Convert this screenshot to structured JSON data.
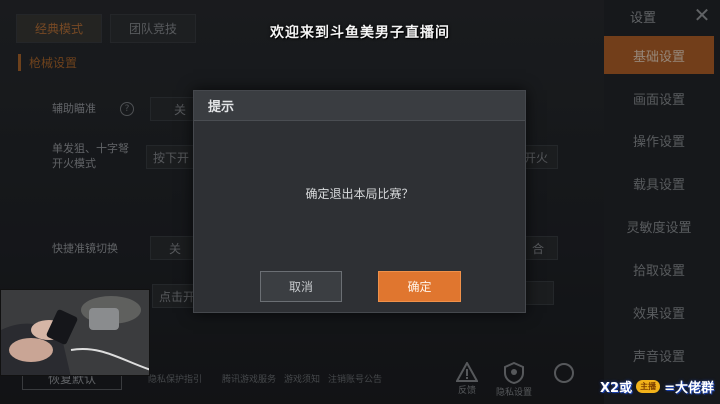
{
  "stream_overlay": {
    "title": "欢迎来到斗鱼美男子直播间"
  },
  "background": {
    "tabs": [
      {
        "label": "经典模式",
        "active": true
      },
      {
        "label": "团队竞技",
        "active": false
      }
    ],
    "section_title": "枪械设置",
    "rows": [
      {
        "label": "辅助瞄准",
        "option": "关"
      },
      {
        "label": "单发狙、十字弩\n开火模式",
        "option": "按下开",
        "option_right": "开火"
      },
      {
        "label": "快捷准镜切换",
        "option": "关",
        "option_right": "合"
      },
      {
        "option": "点击开"
      }
    ],
    "save_button": "恢复默认",
    "bottom_links": [
      "隐私保护指引",
      "腾讯游戏服务",
      "游戏须知",
      "注销账号公告"
    ],
    "bottom_buttons": [
      {
        "label": "反馈"
      },
      {
        "label": "隐私设置"
      }
    ]
  },
  "sidebar": {
    "title": "设置",
    "items": [
      {
        "label": "基础设置",
        "active": true
      },
      {
        "label": "画面设置",
        "active": false
      },
      {
        "label": "操作设置",
        "active": false
      },
      {
        "label": "载具设置",
        "active": false
      },
      {
        "label": "灵敏度设置",
        "active": false
      },
      {
        "label": "拾取设置",
        "active": false
      },
      {
        "label": "效果设置",
        "active": false
      },
      {
        "label": "声音设置",
        "active": false
      }
    ]
  },
  "dialog": {
    "title": "提示",
    "message": "确定退出本局比赛？",
    "cancel_label": "取消",
    "confirm_label": "确定"
  },
  "watermark": {
    "left": "X2或",
    "badge": "主播",
    "right": "=大佬群"
  },
  "colors": {
    "accent": "#e0762f",
    "sidebar_active": "#b8652b"
  }
}
